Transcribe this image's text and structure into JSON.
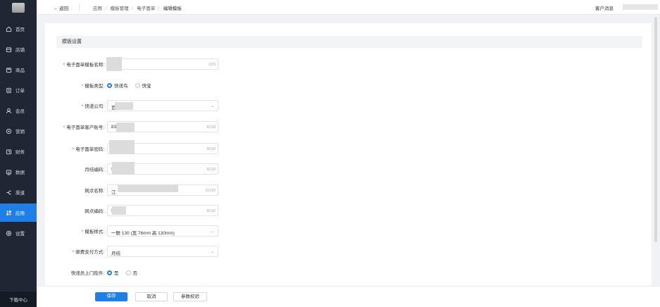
{
  "sidebar": {
    "items": [
      {
        "label": "首页",
        "icon": "home-icon"
      },
      {
        "label": "店铺",
        "icon": "store-icon"
      },
      {
        "label": "商品",
        "icon": "goods-icon"
      },
      {
        "label": "订单",
        "icon": "order-icon"
      },
      {
        "label": "会员",
        "icon": "member-icon"
      },
      {
        "label": "营销",
        "icon": "marketing-icon"
      },
      {
        "label": "财务",
        "icon": "finance-icon"
      },
      {
        "label": "数据",
        "icon": "data-icon"
      },
      {
        "label": "渠道",
        "icon": "channel-icon"
      },
      {
        "label": "应用",
        "icon": "apps-icon",
        "active": true
      },
      {
        "label": "设置",
        "icon": "settings-icon"
      }
    ],
    "footer_label": "下载中心"
  },
  "header": {
    "back_label": "← 返回",
    "breadcrumb": [
      "应用",
      "模板管理",
      "电子面单",
      "编辑模板"
    ],
    "messages_label": "客户消息"
  },
  "section": {
    "title": "模板设置"
  },
  "form": {
    "template_name": {
      "label": "电子面单模板名称:",
      "value": "",
      "count": "2/20"
    },
    "template_type": {
      "label": "模板类型:",
      "options": [
        "快递鸟",
        "快宝"
      ],
      "selected": "快递鸟"
    },
    "courier": {
      "label": "快递公司:",
      "value": "百"
    },
    "account": {
      "label": "电子面单客户账号:",
      "value": "83",
      "count": "8/128"
    },
    "password": {
      "label": "电子面单密码:",
      "value": "",
      "count": "8/128"
    },
    "monthly_code": {
      "label": "月结编码:",
      "value": "!",
      "count": "8/128"
    },
    "outlet_name": {
      "label": "网点名称:",
      "value": "江",
      "count": "10/128"
    },
    "outlet_code": {
      "label": "网点编码:",
      "value": "!",
      "count": "8/128"
    },
    "template_style": {
      "label": "模板样式:",
      "value": "一联 130 (宽 76mm 高 130mm)"
    },
    "payment_method": {
      "label": "邮费支付方式:",
      "value": "月结"
    },
    "pickup": {
      "label": "快递员上门揽件:",
      "options": [
        "是",
        "否"
      ],
      "selected": "是"
    }
  },
  "footer": {
    "save_label": "保存",
    "cancel_label": "取消",
    "check_label": "参数校验"
  },
  "colors": {
    "accent": "#1f7fe8",
    "sidebar_bg": "#1e2733",
    "required": "#e34d4d"
  }
}
